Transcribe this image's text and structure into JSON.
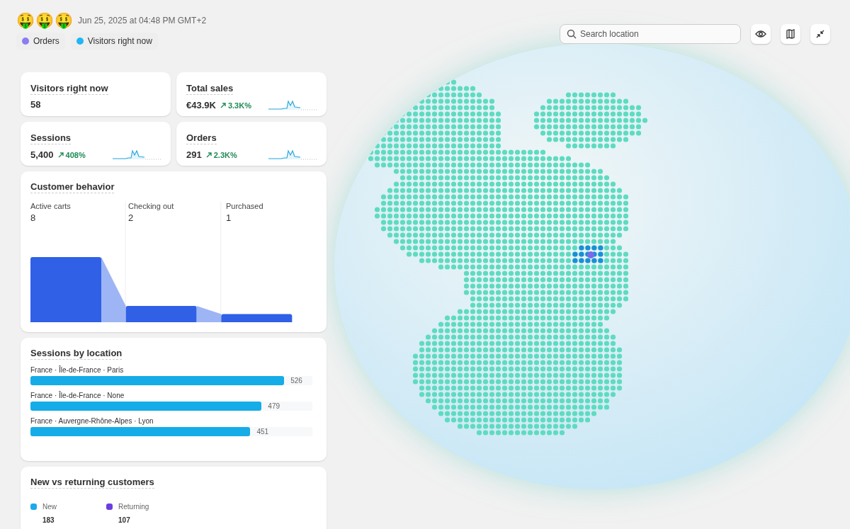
{
  "header": {
    "emojis": [
      "🤑",
      "🤑",
      "🤑"
    ],
    "timestamp": "Jun 25, 2025 at 04:48 PM GMT+2",
    "legend": [
      {
        "label": "Orders",
        "color": "#8b7cf0"
      },
      {
        "label": "Visitors right now",
        "color": "#1fb6f5"
      }
    ]
  },
  "metrics": [
    {
      "title": "Visitors right now",
      "value": "58",
      "sparkline": false
    },
    {
      "title": "Total sales",
      "value": "€43.9K",
      "change": "3.3K%",
      "sparkline": true
    },
    {
      "title": "Sessions",
      "value": "5,400",
      "change": "408%",
      "sparkline": true
    },
    {
      "title": "Orders",
      "value": "291",
      "change": "2.3K%",
      "sparkline": true
    }
  ],
  "customer_behavior": {
    "title": "Customer behavior",
    "steps": [
      {
        "label": "Active carts",
        "value": "8"
      },
      {
        "label": "Checking out",
        "value": "2"
      },
      {
        "label": "Purchased",
        "value": "1"
      }
    ]
  },
  "sessions_by_location": {
    "title": "Sessions by location",
    "rows": [
      {
        "label": "France · Île-de-France · Paris",
        "value": "526",
        "level": 0.9
      },
      {
        "label": "France · Île-de-France · None",
        "value": "479",
        "level": 0.82
      },
      {
        "label": "France · Auvergne-Rhône-Alpes · Lyon",
        "value": "451",
        "level": 0.78
      }
    ]
  },
  "new_vs_returning": {
    "title": "New vs returning customers",
    "items": [
      {
        "label": "New",
        "value": "183",
        "color": "#1ba9ec"
      },
      {
        "label": "Returning",
        "value": "107",
        "color": "#6a3fe0"
      }
    ]
  },
  "map_toolbar": {
    "search": {
      "placeholder": "Search location"
    }
  }
}
